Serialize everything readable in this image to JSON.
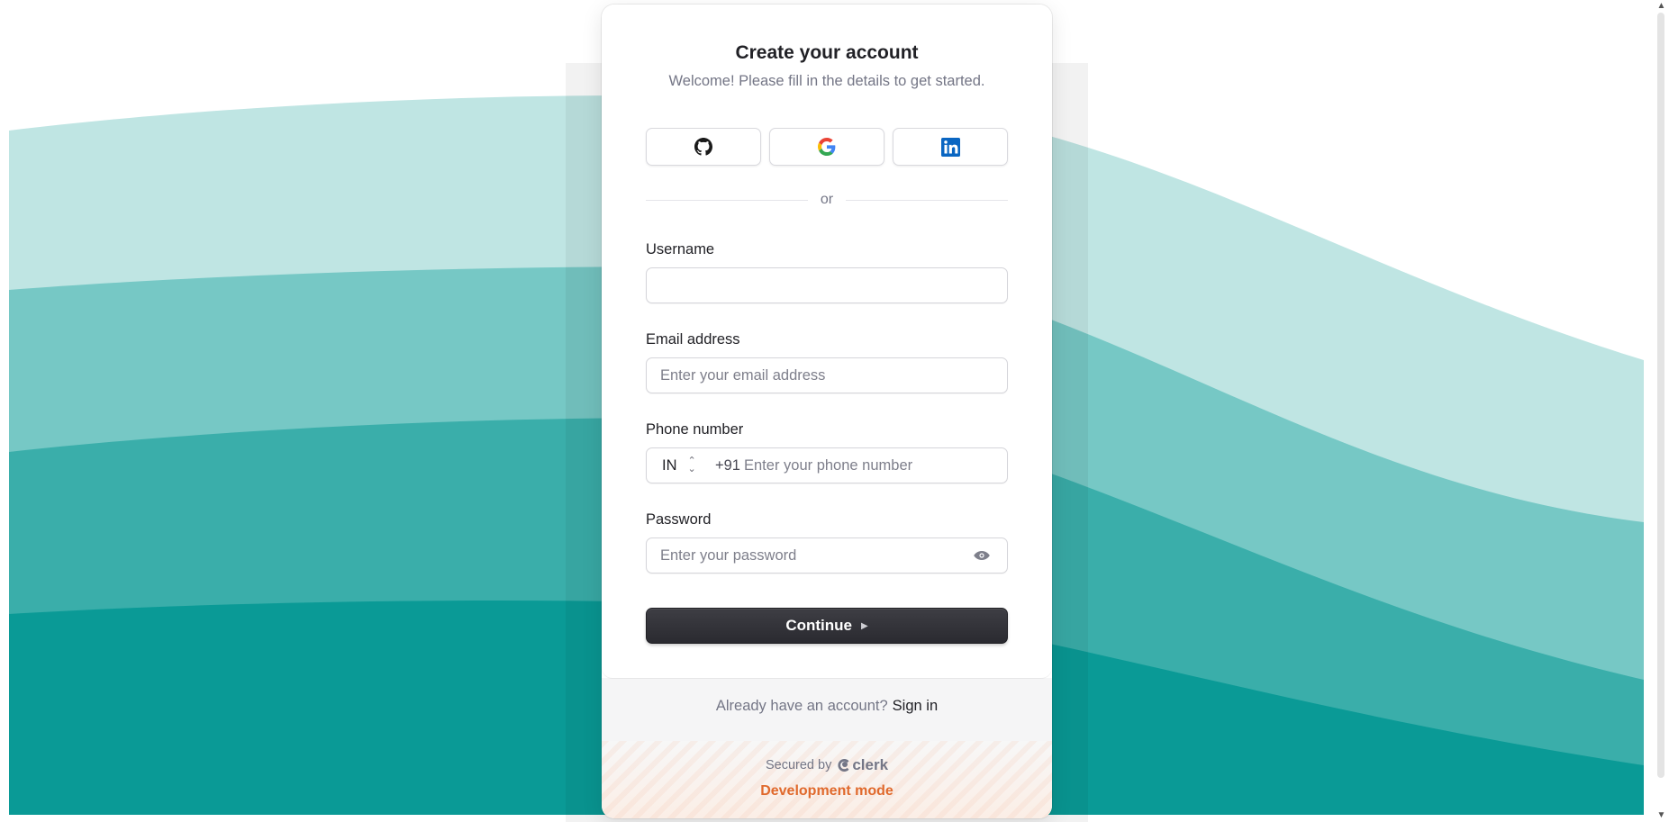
{
  "card": {
    "title": "Create your account",
    "subtitle": "Welcome! Please fill in the details to get started."
  },
  "social": [
    {
      "provider": "GitHub",
      "icon": "github-icon"
    },
    {
      "provider": "Google",
      "icon": "google-icon"
    },
    {
      "provider": "LinkedIn",
      "icon": "linkedin-icon"
    }
  ],
  "divider": {
    "text": "or"
  },
  "form": {
    "username": {
      "label": "Username",
      "value": "",
      "placeholder": ""
    },
    "email": {
      "label": "Email address",
      "value": "",
      "placeholder": "Enter your email address"
    },
    "phone": {
      "label": "Phone number",
      "country": "IN",
      "prefix": "+91",
      "placeholder": "Enter your phone number"
    },
    "password": {
      "label": "Password",
      "placeholder": "Enter your password",
      "toggle_icon": "eye-icon"
    }
  },
  "continue": {
    "label": "Continue",
    "icon": "caret-right-icon"
  },
  "footer": {
    "signin_prompt": "Already have an account?",
    "signin_link": "Sign in",
    "secured_by": "Secured by",
    "brand": "clerk",
    "dev_mode": "Development mode"
  },
  "colors": {
    "teal_dark": "#0a9a96",
    "teal_mid": "#3aaeaa",
    "teal_light": "#76c8c5",
    "teal_pale": "#bfe5e3",
    "button": "#2f2f35",
    "dev_mode": "#e0692c"
  }
}
